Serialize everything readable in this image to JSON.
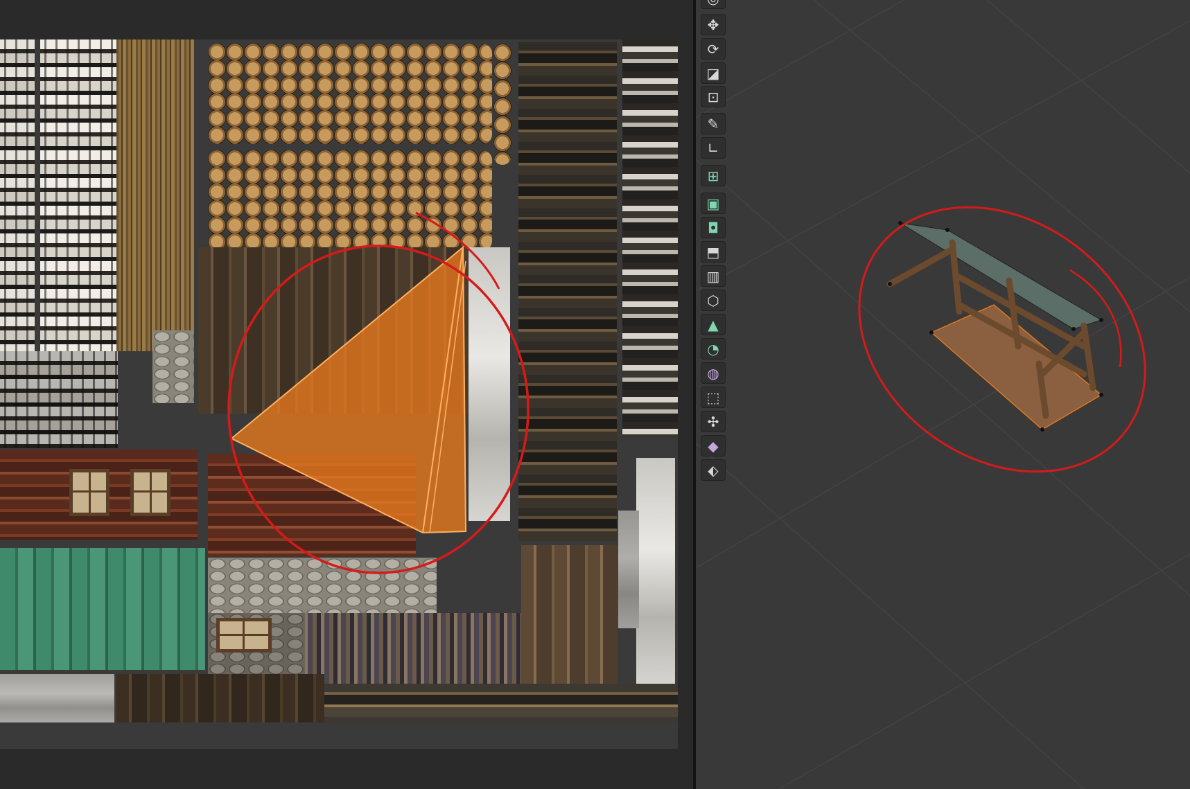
{
  "app": {
    "accent_colors": {
      "selection_orange": "#e0761e",
      "annotation_red": "#d61a1a",
      "editor_background": "#2a2a2a",
      "viewport_background": "#393939"
    }
  },
  "uv_editor": {
    "texture_regions": [
      "birch-bark-strip",
      "oak-bark-strip",
      "stacked-firewood-top",
      "stacked-firewood-bottom",
      "wooden-door-panel",
      "red-wooden-wall-with-windows",
      "green-metal-siding",
      "stone-foundation",
      "plank-strips"
    ],
    "selected_uv_shape": "triangle",
    "annotation": "red-circle"
  },
  "toolbar": {
    "tools": [
      {
        "icon": "cursor-icon"
      },
      {
        "icon": "move-icon"
      },
      {
        "icon": "rotate-icon"
      },
      {
        "icon": "scale-icon"
      },
      {
        "icon": "transform-icon"
      },
      {
        "icon": "annotate-icon"
      },
      {
        "icon": "measure-icon"
      },
      {
        "icon": "add-cube-icon"
      },
      {
        "icon": "extrude-region-icon"
      },
      {
        "icon": "inset-faces-icon"
      },
      {
        "icon": "bevel-icon"
      },
      {
        "icon": "loop-cut-icon"
      },
      {
        "icon": "knife-icon"
      },
      {
        "icon": "poly-build-icon"
      },
      {
        "icon": "spin-icon"
      },
      {
        "icon": "smooth-icon"
      },
      {
        "icon": "edge-slide-icon"
      },
      {
        "icon": "shrink-fatten-icon"
      },
      {
        "icon": "shear-icon"
      },
      {
        "icon": "rip-region-icon"
      }
    ]
  },
  "viewport": {
    "selected_object": "wooden-shelter",
    "annotation": "red-ellipse"
  }
}
